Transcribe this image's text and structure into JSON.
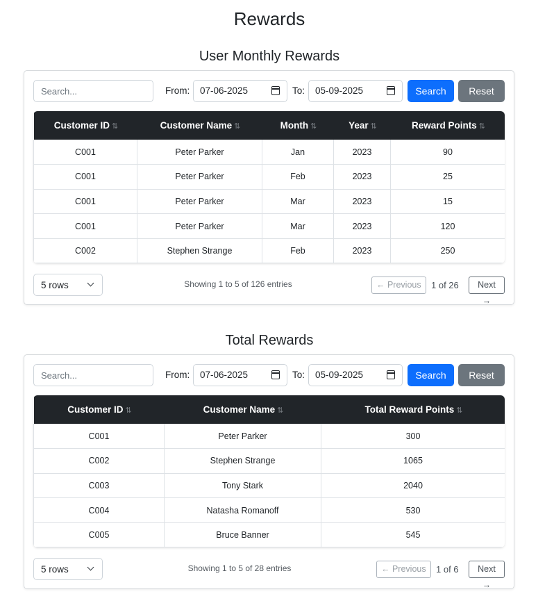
{
  "page_title": "Rewards",
  "monthly": {
    "title": "User Monthly Rewards",
    "search_placeholder": "Search...",
    "from_label": "From:",
    "from_value": "07-06-2025",
    "to_label": "To:",
    "to_value": "05-09-2025",
    "search_button": "Search",
    "reset_button": "Reset",
    "columns": [
      "Customer ID",
      "Customer Name",
      "Month",
      "Year",
      "Reward Points"
    ],
    "rows": [
      [
        "C001",
        "Peter Parker",
        "Jan",
        "2023",
        "90"
      ],
      [
        "C001",
        "Peter Parker",
        "Feb",
        "2023",
        "25"
      ],
      [
        "C001",
        "Peter Parker",
        "Mar",
        "2023",
        "15"
      ],
      [
        "C001",
        "Peter Parker",
        "Mar",
        "2023",
        "120"
      ],
      [
        "C002",
        "Stephen Strange",
        "Feb",
        "2023",
        "250"
      ]
    ],
    "rows_select": "5 rows",
    "showing": "Showing 1 to 5 of 126 entries",
    "prev": "← Previous",
    "page_info": "1 of 26",
    "next": "Next →"
  },
  "total": {
    "title": "Total Rewards",
    "search_placeholder": "Search...",
    "from_label": "From:",
    "from_value": "07-06-2025",
    "to_label": "To:",
    "to_value": "05-09-2025",
    "search_button": "Search",
    "reset_button": "Reset",
    "columns": [
      "Customer ID",
      "Customer Name",
      "Total Reward Points"
    ],
    "rows": [
      [
        "C001",
        "Peter Parker",
        "300"
      ],
      [
        "C002",
        "Stephen Strange",
        "1065"
      ],
      [
        "C003",
        "Tony Stark",
        "2040"
      ],
      [
        "C004",
        "Natasha Romanoff",
        "530"
      ],
      [
        "C005",
        "Bruce Banner",
        "545"
      ]
    ],
    "rows_select": "5 rows",
    "showing": "Showing 1 to 5 of 28 entries",
    "prev": "← Previous",
    "page_info": "1 of 6",
    "next": "Next →"
  },
  "icons": {
    "sort": "sort-updown-icon",
    "calendar": "calendar-icon",
    "chevron": "chevron-down-icon"
  },
  "colors": {
    "primary": "#0d6efd",
    "secondary": "#6c757d",
    "header_bg": "#212529"
  }
}
